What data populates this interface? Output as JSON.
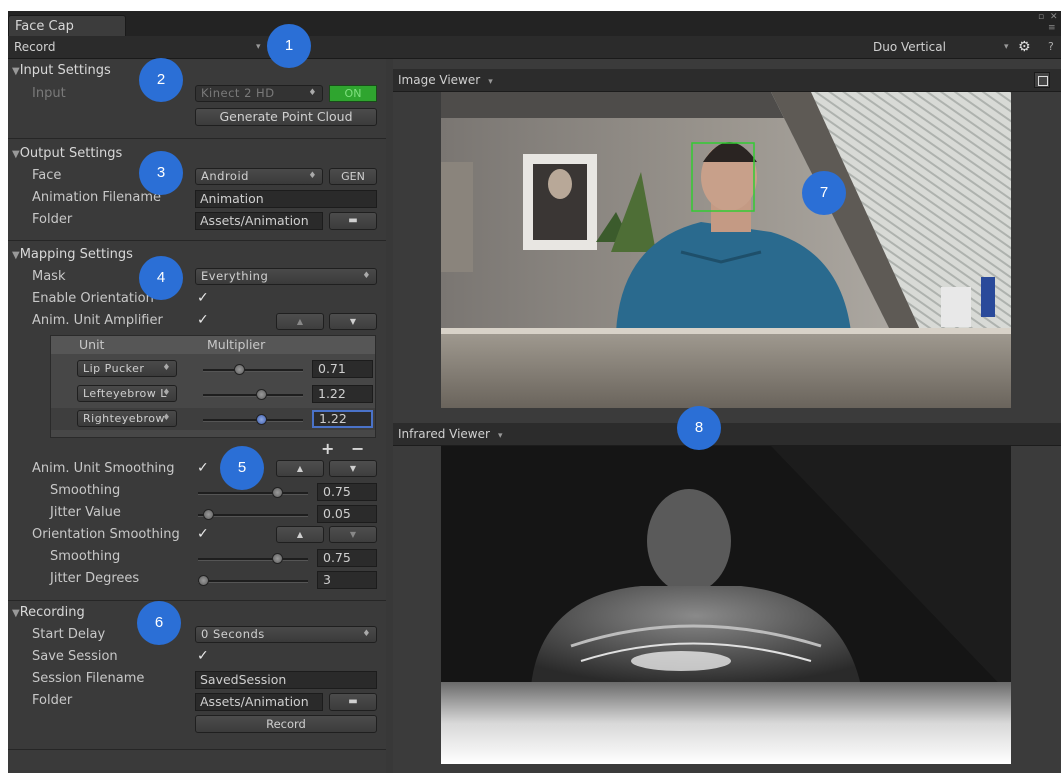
{
  "window": {
    "tab_title": "Face Cap",
    "corner_icons": [
      "pin-icon",
      "close-icon",
      "menu-icon"
    ]
  },
  "toolbar": {
    "mode": "Record",
    "layout": "Duo Vertical",
    "help": "?"
  },
  "input_settings": {
    "header": "Input Settings",
    "input_label": "Input",
    "device": "Kinect 2 HD",
    "toggle": "ON",
    "generate_button": "Generate Point Cloud"
  },
  "output_settings": {
    "header": "Output Settings",
    "face_label": "Face",
    "face_value": "Android",
    "gen_button": "GEN",
    "anim_filename_label": "Animation Filename",
    "anim_filename_value": "Animation",
    "folder_label": "Folder",
    "folder_value": "Assets/Animation"
  },
  "mapping_settings": {
    "header": "Mapping Settings",
    "mask_label": "Mask",
    "mask_value": "Everything",
    "enable_orientation_label": "Enable Orientation",
    "amplifier_label": "Anim. Unit Amplifier",
    "table": {
      "col_unit": "Unit",
      "col_multiplier": "Multiplier",
      "rows": [
        {
          "unit": "Lip Pucker",
          "value": "0.71",
          "level": 0.35
        },
        {
          "unit": "Lefteyebrow L",
          "value": "1.22",
          "level": 0.6
        },
        {
          "unit": "Righteyebrow",
          "value": "1.22",
          "level": 0.6
        }
      ],
      "add": "+",
      "remove": "−"
    },
    "smoothing_label": "Anim. Unit Smoothing",
    "smoothing_sub_label": "Smoothing",
    "smoothing_value": "0.75",
    "smoothing_level": 0.75,
    "jitter_label": "Jitter Value",
    "jitter_value": "0.05",
    "jitter_level": 0.05,
    "orientation_smoothing_label": "Orientation Smoothing",
    "orient_smoothing_sub_label": "Smoothing",
    "orient_smoothing_value": "0.75",
    "orient_smoothing_level": 0.75,
    "jitter_degrees_label": "Jitter Degrees",
    "jitter_degrees_value": "3",
    "jitter_degrees_level": 0.0
  },
  "recording": {
    "header": "Recording",
    "start_delay_label": "Start Delay",
    "start_delay_value": "0 Seconds",
    "save_session_label": "Save Session",
    "session_filename_label": "Session Filename",
    "session_filename_value": "SavedSession",
    "folder_label": "Folder",
    "folder_value": "Assets/Animation",
    "record_button": "Record"
  },
  "viewers": {
    "image_viewer": "Image Viewer",
    "infrared_viewer": "Infrared Viewer"
  },
  "callouts": [
    "1",
    "2",
    "3",
    "4",
    "5",
    "6",
    "7",
    "8"
  ],
  "colors": {
    "callout": "#2b6fd6",
    "toggle_on": "#2fa52f",
    "face_box": "#33cc33",
    "selected_field_border": "#4a72c8"
  }
}
